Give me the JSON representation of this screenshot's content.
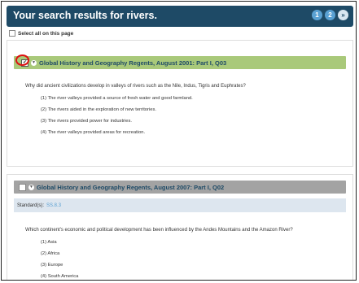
{
  "header": {
    "title": "Your search results for rivers.",
    "pages": [
      "1",
      "2",
      "»"
    ]
  },
  "select_all_label": "Select all on this page",
  "questions": [
    {
      "title": "Global History and Geography Regents, August 2001: Part I, Q03",
      "prompt": "Why did ancient civilizations develop in valleys of rivers such as the Nile, Indus, Tigris and Euphrates?",
      "options": [
        "(1) The river valleys provided a source of fresh water and good farmland.",
        "(2) The rivers aided in the exploration of new territories.",
        "(3) The rivers provided power for industries.",
        "(4) The river valleys provided areas for recreation."
      ],
      "selected": true
    },
    {
      "title": "Global History and Geography Regents, August 2007: Part I, Q02",
      "standards_label": "Standard(s):",
      "standards_value": "SS.8.3",
      "prompt": "Which continent's economic and political development has been influenced by the Andes Mountains and the Amazon River?",
      "options": [
        "(1) Asia",
        "(2) Africa",
        "(3) Europe",
        "(4) South America"
      ],
      "selected": false
    }
  ],
  "colors": {
    "header_bg": "#1e4a66",
    "selected_bar": "#a9c97a",
    "unselected_bar": "#a3a3a3",
    "highlight_ring": "#dd1111"
  }
}
